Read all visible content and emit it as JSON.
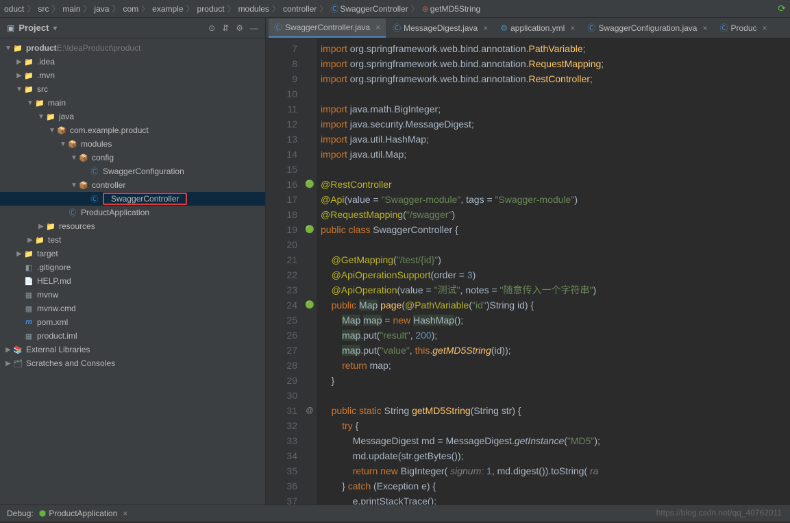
{
  "breadcrumb": [
    "oduct",
    "src",
    "main",
    "java",
    "com",
    "example",
    "product",
    "modules",
    "controller",
    "SwaggerController",
    "getMD5String"
  ],
  "sidebar": {
    "title": "Project",
    "toolbar": [
      "⚙",
      "⇵",
      "⊞",
      "—"
    ],
    "tree": [
      {
        "indent": 0,
        "arrow": "▼",
        "icon": "📁",
        "label": "product",
        "suffix": "  E:\\IdeaProduct\\product",
        "bold": true
      },
      {
        "indent": 1,
        "arrow": "▶",
        "icon": "📁",
        "label": ".idea"
      },
      {
        "indent": 1,
        "arrow": "▶",
        "icon": "📁",
        "label": ".mvn"
      },
      {
        "indent": 1,
        "arrow": "▼",
        "icon": "📁",
        "label": "src"
      },
      {
        "indent": 2,
        "arrow": "▼",
        "icon": "📁",
        "label": "main"
      },
      {
        "indent": 3,
        "arrow": "▼",
        "icon": "📁",
        "label": "java"
      },
      {
        "indent": 4,
        "arrow": "▼",
        "icon": "📦",
        "label": "com.example.product"
      },
      {
        "indent": 5,
        "arrow": "▼",
        "icon": "📦",
        "label": "modules"
      },
      {
        "indent": 6,
        "arrow": "▼",
        "icon": "📦",
        "label": "config"
      },
      {
        "indent": 7,
        "arrow": "",
        "icon": "Ⓒ",
        "label": "SwaggerConfiguration",
        "cls": true
      },
      {
        "indent": 6,
        "arrow": "▼",
        "icon": "📦",
        "label": "controller"
      },
      {
        "indent": 7,
        "arrow": "",
        "icon": "Ⓒ",
        "label": "SwaggerController",
        "selected": true,
        "hl": true,
        "cls": true
      },
      {
        "indent": 5,
        "arrow": "",
        "icon": "Ⓒ",
        "label": "ProductApplication",
        "cls": true
      },
      {
        "indent": 3,
        "arrow": "▶",
        "icon": "📁",
        "label": "resources"
      },
      {
        "indent": 2,
        "arrow": "▶",
        "icon": "📁",
        "label": "test"
      },
      {
        "indent": 1,
        "arrow": "▶",
        "icon": "📁",
        "label": "target",
        "orange": true
      },
      {
        "indent": 1,
        "arrow": "",
        "icon": "◧",
        "label": ".gitignore"
      },
      {
        "indent": 1,
        "arrow": "",
        "icon": "📄",
        "label": "HELP.md"
      },
      {
        "indent": 1,
        "arrow": "",
        "icon": "▦",
        "label": "mvnw"
      },
      {
        "indent": 1,
        "arrow": "",
        "icon": "▦",
        "label": "mvnw.cmd"
      },
      {
        "indent": 1,
        "arrow": "",
        "icon": "m",
        "label": "pom.xml",
        "mvn": true
      },
      {
        "indent": 1,
        "arrow": "",
        "icon": "▦",
        "label": "product.iml"
      },
      {
        "indent": 0,
        "arrow": "▶",
        "icon": "📚",
        "label": "External Libraries"
      },
      {
        "indent": 0,
        "arrow": "▶",
        "icon": "🗂",
        "label": "Scratches and Consoles"
      }
    ]
  },
  "tabs": [
    {
      "icon": "Ⓒ",
      "label": "SwaggerController.java",
      "active": true
    },
    {
      "icon": "Ⓒ",
      "label": "MessageDigest.java"
    },
    {
      "icon": "⚙",
      "label": "application.yml"
    },
    {
      "icon": "Ⓒ",
      "label": "SwaggerConfiguration.java"
    },
    {
      "icon": "Ⓒ",
      "label": "Produc"
    }
  ],
  "code_start": 7,
  "code_lines": [
    "<span class='kw'>import</span> org.springframework.web.bind.annotation.<span class='fn'>PathVariable</span>;",
    "<span class='kw'>import</span> org.springframework.web.bind.annotation.<span class='fn'>RequestMapping</span>;",
    "<span class='kw'>import</span> org.springframework.web.bind.annotation.<span class='fn'>RestController</span>;",
    "",
    "<span class='kw'>import</span> java.math.BigInteger;",
    "<span class='kw'>import</span> java.security.MessageDigest;",
    "<span class='kw'>import</span> java.util.HashMap;",
    "<span class='kw'>import</span> java.util.Map;",
    "",
    "<span class='ann'>@RestController</span>",
    "<span class='ann'>@Api</span>(value = <span class='str'>\"Swagger-module\"</span>, tags = <span class='str'>\"Swagger-module\"</span>)",
    "<span class='ann'>@RequestMapping</span>(<span class='str'>\"/swagger\"</span>)",
    "<span class='kw'>public class</span> SwaggerController {",
    "",
    "    <span class='ann'>@GetMapping</span>(<span class='str'>\"/test/{id}\"</span>)",
    "    <span class='ann'>@ApiOperationSupport</span>(order = <span class='num'>3</span>)",
    "    <span class='ann'>@ApiOperation</span>(value = <span class='str'>\"测试\"</span>, notes = <span class='str'>\"随意传入一个字符串\"</span>)",
    "    <span class='kw'>public</span> <span class='hl-bg'>Map</span> <span class='fn'>page</span>(<span class='ann'>@PathVariable</span>(<span class='str'>\"id\"</span>)String id) {",
    "        <span class='hl-bg'>Map</span> <span class='hl-bg'>map</span> = <span class='kw'>new</span> <span class='hl-bg'>HashMap</span>();",
    "        <span class='hl-bg'>map</span>.put(<span class='str'>\"result\"</span>, <span class='num'>200</span>);",
    "        <span class='hl-bg'>map</span>.put(<span class='str'>\"value\"</span>, <span class='kw'>this</span>.<span class='fn it'>getMD5String</span>(id));",
    "        <span class='kw'>return</span> map;",
    "    }",
    "",
    "    <span class='kw'>public static</span> String <span class='fn'>getMD5String</span>(String str) {",
    "        <span class='kw'>try</span> {",
    "            MessageDigest md = MessageDigest.<span class='it'>getInstance</span>(<span class='str'>\"MD5\"</span>);",
    "            md.update(str.getBytes());",
    "            <span class='kw'>return new</span> BigInteger( <span class='param'>signum:</span> <span class='num'>1</span>, md.digest()).toString( <span class='param'>ra</span>",
    "        } <span class='kw'>catch</span> (Exception e) {",
    "            e.printStackTrace();"
  ],
  "gutter_marks": {
    "16": "🟢",
    "19": "🟢",
    "24": "🟢",
    "31": "@"
  },
  "debug": {
    "label": "Debug:",
    "tab": "ProductApplication"
  },
  "watermark": "https://blog.csdn.net/qq_40762011"
}
